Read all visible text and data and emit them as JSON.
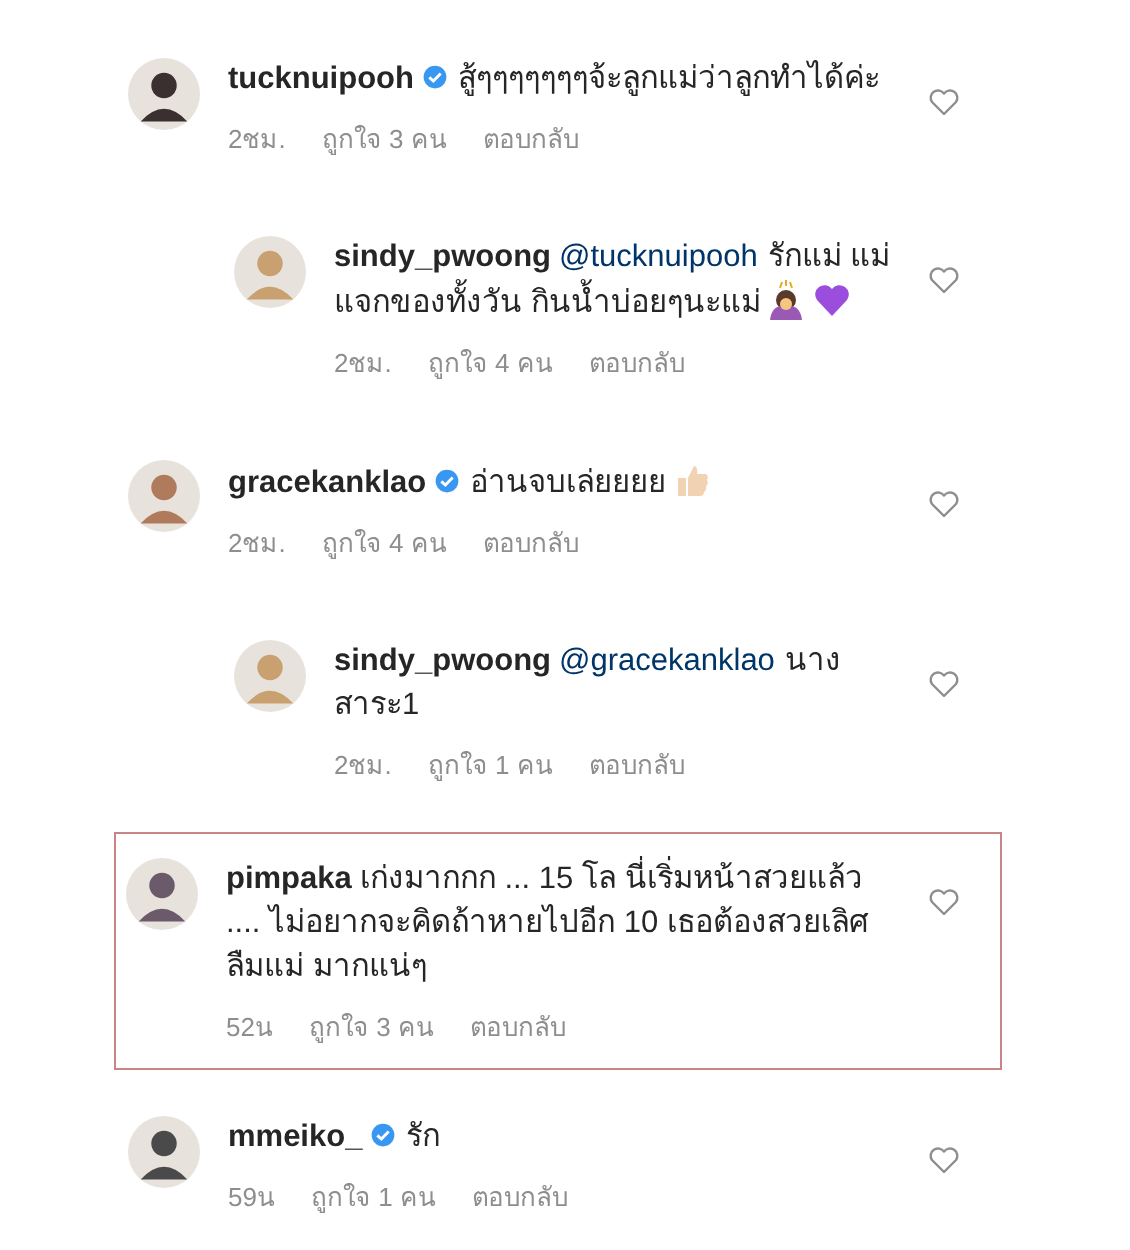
{
  "comments": [
    {
      "kind": "comment",
      "username": "tucknuipooh",
      "verified": true,
      "text": "สู้ๆๆๆๆๆๆๆจ้ะลูกแม่ว่าลูกทำได้ค่ะ",
      "time": "2ชม.",
      "likes": "ถูกใจ 3 คน",
      "reply": "ตอบกลับ",
      "highlighted": false
    },
    {
      "kind": "reply",
      "username": "sindy_pwoong",
      "verified": false,
      "mention": "@tucknuipooh",
      "text": "รักแม่ แม่แจกของทั้งวัน กินน้ำบ่อยๆนะแม่",
      "time": "2ชม.",
      "likes": "ถูกใจ 4 คน",
      "reply": "ตอบกลับ",
      "highlighted": false,
      "bow_emoji": true,
      "heart_emoji": true
    },
    {
      "kind": "comment",
      "username": "gracekanklao",
      "verified": true,
      "text": "อ่านจบเล่ยยยย",
      "time": "2ชม.",
      "likes": "ถูกใจ 4 คน",
      "reply": "ตอบกลับ",
      "highlighted": false,
      "thumbs_emoji": true
    },
    {
      "kind": "reply",
      "username": "sindy_pwoong",
      "verified": false,
      "mention": "@gracekanklao",
      "text": "นางสาระ1",
      "time": "2ชม.",
      "likes": "ถูกใจ 1 คน",
      "reply": "ตอบกลับ",
      "highlighted": false
    },
    {
      "kind": "comment",
      "username": "pimpaka",
      "verified": false,
      "text": "เก่งมากกก ... 15 โล นี่เริ่มหน้าสวยแล้ว .... ไม่อยากจะคิดถ้าหายไปอีก 10 เธอต้องสวยเลิศ ลืมแม่ มากแน่ๆ",
      "time": "52น",
      "likes": "ถูกใจ 3 คน",
      "reply": "ตอบกลับ",
      "highlighted": true
    },
    {
      "kind": "comment",
      "username": "mmeiko_",
      "verified": true,
      "text": "รัก",
      "time": "59น",
      "likes": "ถูกใจ 1 คน",
      "reply": "ตอบกลับ",
      "highlighted": false
    }
  ]
}
